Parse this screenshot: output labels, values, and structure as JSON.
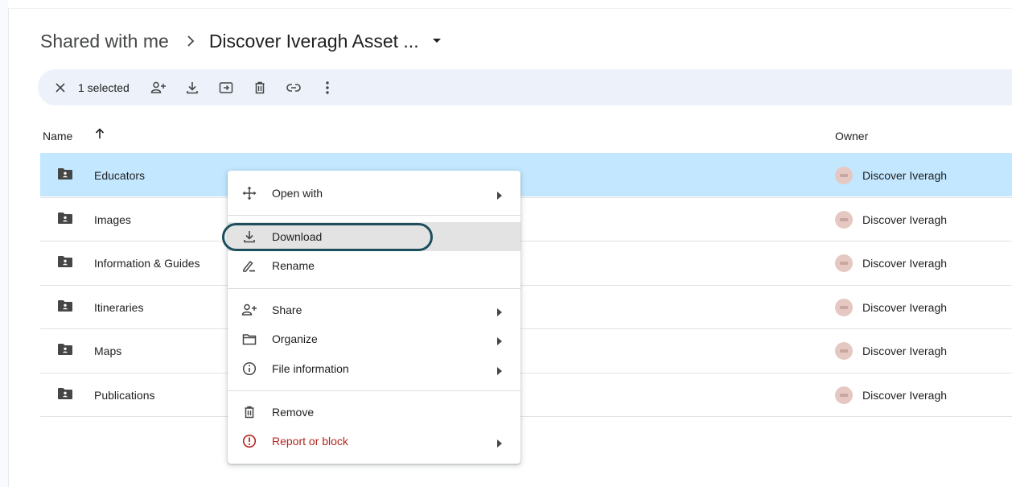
{
  "breadcrumb": {
    "root": "Shared with me",
    "current": "Discover Iveragh Asset ..."
  },
  "selection_bar": {
    "count_label": "1 selected"
  },
  "table": {
    "columns": {
      "name": "Name",
      "owner": "Owner"
    },
    "rows": [
      {
        "name": "Educators",
        "owner": "Discover Iveragh",
        "selected": true
      },
      {
        "name": "Images",
        "owner": "Discover Iveragh"
      },
      {
        "name": "Information & Guides",
        "owner": "Discover Iveragh"
      },
      {
        "name": "Itineraries",
        "owner": "Discover Iveragh"
      },
      {
        "name": "Maps",
        "owner": "Discover Iveragh"
      },
      {
        "name": "Publications",
        "owner": "Discover Iveragh"
      }
    ]
  },
  "context_menu": {
    "items": [
      {
        "label": "Open with",
        "icon": "open-with-icon",
        "submenu": true
      },
      {
        "label": "Download",
        "icon": "download-icon",
        "highlighted": true
      },
      {
        "label": "Rename",
        "icon": "rename-icon"
      },
      {
        "label": "Share",
        "icon": "share-icon",
        "submenu": true
      },
      {
        "label": "Organize",
        "icon": "folder-icon",
        "submenu": true
      },
      {
        "label": "File information",
        "icon": "info-icon",
        "submenu": true
      },
      {
        "label": "Remove",
        "icon": "trash-icon"
      },
      {
        "label": "Report or block",
        "icon": "report-icon",
        "submenu": true,
        "danger": true
      }
    ]
  },
  "colors": {
    "selected_row": "#c2e7ff",
    "selection_bar": "#edf2fa",
    "highlight_ring": "#1d4e5c",
    "danger": "#b3261e",
    "avatar": "#e6c8c3"
  }
}
